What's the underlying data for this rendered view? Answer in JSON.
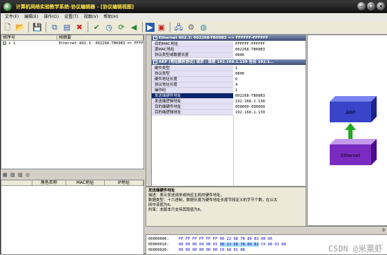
{
  "window": {
    "title": "计算机网络实验教学系统-协议编辑器 - [协议编辑视图]"
  },
  "menu": [
    "文件(F)",
    "编辑(E)",
    "操作(O)",
    "设置(T)",
    "视图(V)",
    "帮助(H)"
  ],
  "packet_list": {
    "columns": [
      "帧序号",
      "帧摘要"
    ],
    "rows": [
      {
        "no": "1",
        "summary": "Ethernet 802.3: 002268-TB09B3 => FFFFFF"
      }
    ]
  },
  "host_table": {
    "columns": [
      "角色名称",
      "MAC地址",
      "IP地址"
    ]
  },
  "ethernet": {
    "header": "Ethernet 802.3: 002268-TB09B3 => FFFFFF-FFFFFF",
    "fields": [
      {
        "name": "目的MAC地址",
        "value": "FFFFFF-FFFFFF"
      },
      {
        "name": "源MAC地址",
        "value": "002268-TB09B3"
      },
      {
        "name": "协议类型或数据长度",
        "value": "0806"
      }
    ]
  },
  "arp": {
    "header": "ARP (地址解析协议) 请求 : 谁是 192.168.1.139 告诉 192.1...",
    "fields": [
      {
        "name": "硬件类型",
        "value": "1"
      },
      {
        "name": "协议类型",
        "value": "0800"
      },
      {
        "name": "硬件地址长度",
        "value": "6"
      },
      {
        "name": "协议地址长度",
        "value": "4"
      },
      {
        "name": "操作码",
        "value": "1"
      },
      {
        "name": "发送端硬件地址",
        "value": "002268-TB09B3"
      },
      {
        "name": "发送端逻辑地址",
        "value": "192.168.1.138"
      },
      {
        "name": "目的端硬件地址",
        "value": "000000-000000"
      },
      {
        "name": "目的端逻辑地址",
        "value": "192.168.1.139"
      }
    ],
    "selected_index": 5
  },
  "description": {
    "title": "发送端硬件地址",
    "lines": [
      "描述：表示发送请求或响应主机的硬件地址。",
      "数据类型：十六进制，数据长度为硬件地址长度字段定义的字节个数，在以太",
      "网中该值为6。",
      "约束：本版本只支持其取值为6。"
    ]
  },
  "diagram": {
    "top": "ARP",
    "bottom": "Ethernet",
    "top_color": "#3a44c8",
    "bottom_color": "#7a2cc0",
    "arrow_color": "#22a822"
  },
  "hex": {
    "header": "0",
    "rows": [
      {
        "addr": "00000000:",
        "pre": "FF FF FF FF FF FF 00 22 68 7B 89 B3 08 06",
        "hi": "",
        "post": "",
        "ascii": ""
      },
      {
        "addr": "00000010:",
        "pre": "08 00 06 04 00 01 ",
        "hi": "00 22 68 7B 89 B3",
        "post": " C0 A8 01 8A",
        "ascii": ""
      },
      {
        "addr": "00000020:",
        "pre": "00 00 00 00 00 00 C0 A8 01 8B",
        "hi": "",
        "post": "",
        "ascii": ""
      }
    ]
  },
  "watermark": "CSDN @米莱虾"
}
